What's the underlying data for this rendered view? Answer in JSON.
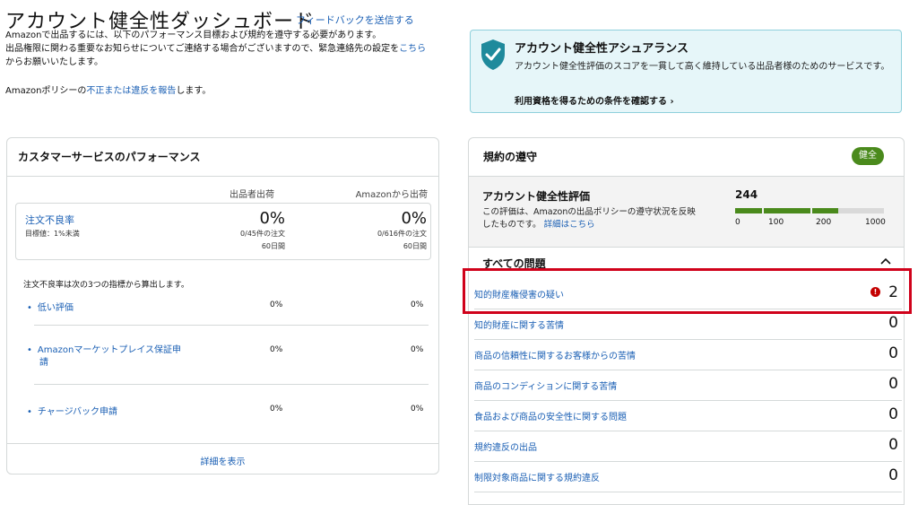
{
  "header": {
    "title": "アカウント健全性ダッシュボード",
    "feedback_link": "フィードバックを送信する",
    "intro_line1": "Amazonで出品するには、以下のパフォーマンス目標および規約を遵守する必要があります。",
    "intro_line2": "出品権限に関わる重要なお知らせについてご連絡する場合がございますので、緊急連絡先の設定を",
    "intro_link": "こちら",
    "intro_line3": "からお願いいたします。",
    "policy_prefix": "Amazonポリシーの",
    "policy_link": "不正または違反を報告",
    "policy_suffix": "します。"
  },
  "assurance": {
    "title": "アカウント健全性アシュアランス",
    "description": "アカウント健全性評価のスコアを一貫して高く維持している出品者様のためのサービスです。",
    "link": "利用資格を得るための条件を確認する",
    "icon": "shield-check-icon",
    "color": "#1f8a9c"
  },
  "customer_service": {
    "title": "カスタマーサービスのパフォーマンス",
    "col_seller": "出品者出荷",
    "col_amazon": "Amazonから出荷",
    "odr": {
      "label": "注文不良率",
      "target": "目標値：1%未満",
      "seller_pct": "0%",
      "seller_orders": "0/45件の注文",
      "seller_period": "60日間",
      "amazon_pct": "0%",
      "amazon_orders": "0/616件の注文",
      "amazon_period": "60日間"
    },
    "formula": "注文不良率は次の3つの指標から算出します。",
    "metrics": [
      {
        "label": "低い評価",
        "seller": "0%",
        "amazon": "0%"
      },
      {
        "label_line1": "Amazonマーケットプレイス保証申",
        "label_line2": "請",
        "seller": "0%",
        "amazon": "0%"
      },
      {
        "label": "チャージバック申請",
        "seller": "0%",
        "amazon": "0%"
      }
    ],
    "details": "詳細を表示"
  },
  "compliance": {
    "title": "規約の遵守",
    "badge": "健全",
    "ahr_title": "アカウント健全性評価",
    "ahr_desc_line1": "この評価は、Amazonの出品ポリシーの遵守状況を反映",
    "ahr_desc_line2": "したものです。",
    "ahr_desc_link": "詳細はこちら",
    "score": "244",
    "score_value": 244,
    "ticks": [
      "0",
      "100",
      "200",
      "1000"
    ],
    "issues_title": "すべての問題",
    "issues": [
      {
        "label": "知的財産権侵害の疑い",
        "count": "2",
        "alert": true
      },
      {
        "label": "知的財産に関する苦情",
        "count": "0"
      },
      {
        "label": "商品の信頼性に関するお客様からの苦情",
        "count": "0"
      },
      {
        "label": "商品のコンディションに関する苦情",
        "count": "0"
      },
      {
        "label": "食品および商品の安全性に関する問題",
        "count": "0"
      },
      {
        "label": "規約違反の出品",
        "count": "0"
      },
      {
        "label": "制限対象商品に関する規約違反",
        "count": "0"
      }
    ],
    "alert_glyph": "!",
    "colors": {
      "healthy": "#4a8a1c",
      "bar_empty": "#d9d9d9",
      "alert": "#c40000",
      "highlight": "#d0021b"
    }
  }
}
